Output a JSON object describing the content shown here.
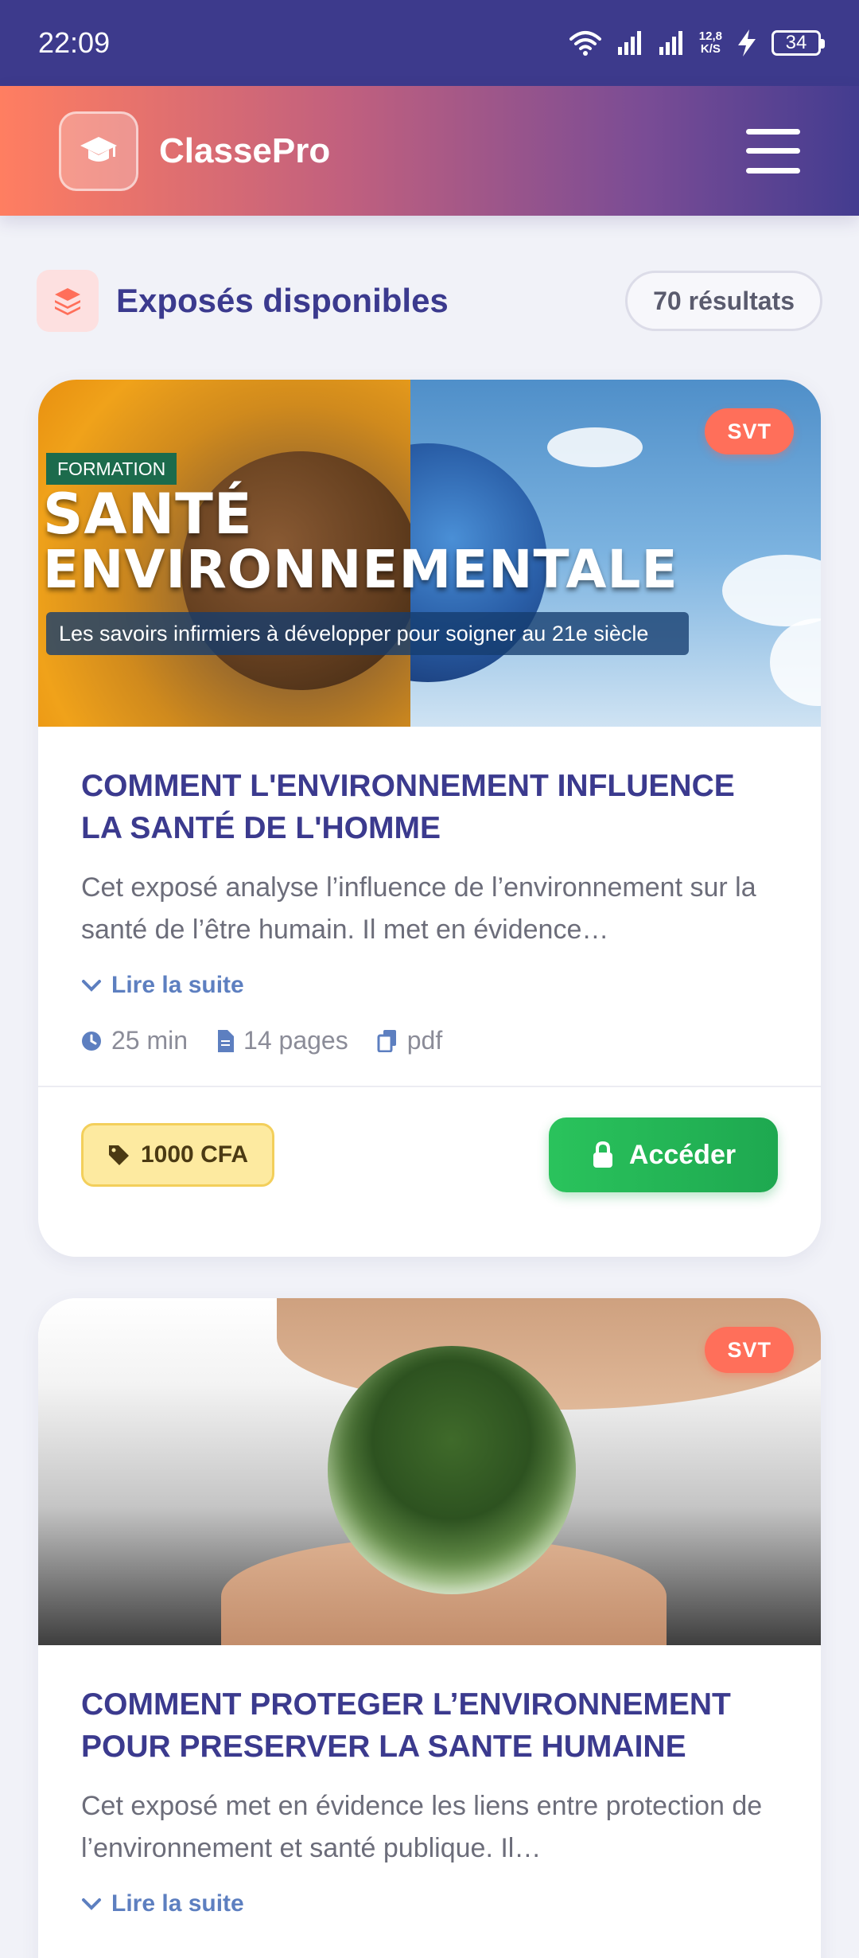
{
  "status_bar": {
    "time": "22:09",
    "net_speed_value": "12,8",
    "net_speed_unit": "K/S",
    "battery": "34"
  },
  "app": {
    "brand": "ClassePro",
    "logo_icon": "graduation-cap-icon",
    "menu_icon": "hamburger-menu-icon",
    "colors": {
      "primary": "#3b3a8e",
      "accent": "#ff6f5a",
      "success": "#1ea850"
    }
  },
  "section": {
    "title": "Exposés disponibles",
    "results": "70 résultats",
    "icon": "layers-icon"
  },
  "cards": [
    {
      "subject": "SVT",
      "image": {
        "tag": "FORMATION",
        "headline_line1": "SANTÉ",
        "headline_line2": "ENVIRONNEMENTALE",
        "subtitle": "Les savoirs infirmiers à développer pour soigner au 21e siècle"
      },
      "title": "COMMENT L'ENVIRONNEMENT INFLUENCE LA SANTÉ DE L'HOMME",
      "description": "Cet exposé analyse l’influence de l’environnement sur la santé de l’être humain. Il met en évidence…",
      "read_more": "Lire la suite",
      "duration": "25 min",
      "pages": "14 pages",
      "format": "pdf",
      "price": "1000 CFA",
      "action": "Accéder"
    },
    {
      "subject": "SVT",
      "title": "COMMENT PROTEGER L’ENVIRONNEMENT POUR PRESERVER LA SANTE HUMAINE",
      "description": "Cet exposé met en évidence les liens entre protection de l’environnement et santé publique. Il…",
      "read_more": "Lire la suite"
    }
  ]
}
